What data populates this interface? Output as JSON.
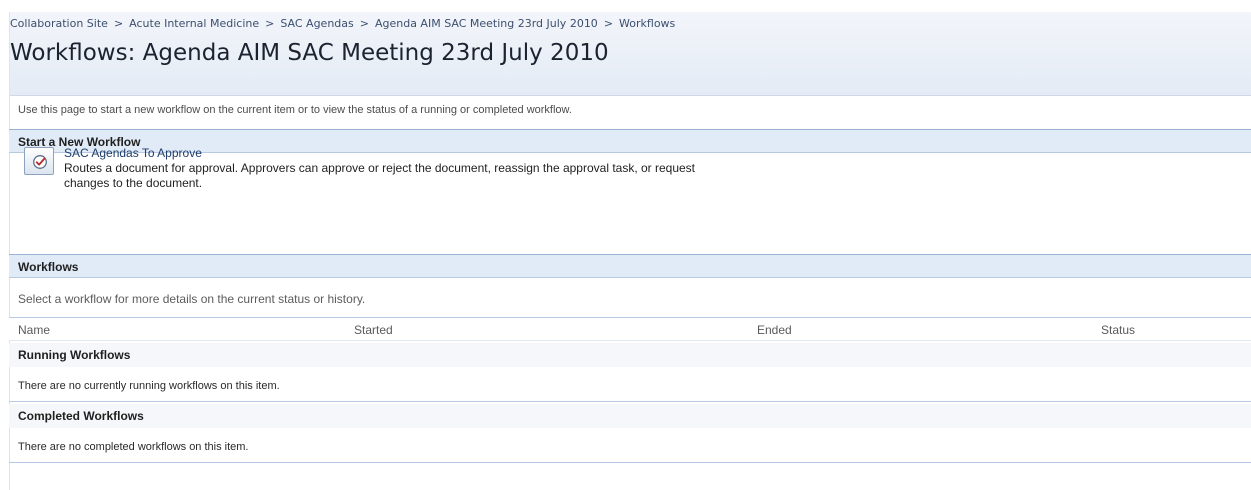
{
  "breadcrumb": [
    "Collaboration Site",
    "Acute Internal Medicine",
    "SAC Agendas",
    "Agenda AIM SAC Meeting 23rd July 2010",
    "Workflows"
  ],
  "breadcrumb_separator": ">",
  "page_title": "Workflows: Agenda AIM SAC Meeting 23rd July 2010",
  "intro_text": "Use this page to start a new workflow on the current item or to view the status of a running or completed workflow.",
  "start_section": {
    "heading": "Start a New Workflow",
    "workflow": {
      "icon": "approval-check-icon",
      "name": "SAC Agendas To Approve",
      "description": "Routes a document for approval. Approvers can approve or reject the document, reassign the approval task, or request changes to the document."
    }
  },
  "workflows_section": {
    "heading": "Workflows",
    "hint": "Select a workflow for more details on the current status or history.",
    "columns": [
      "Name",
      "Started",
      "Ended",
      "Status"
    ],
    "running": {
      "heading": "Running Workflows",
      "empty_message": "There are no currently running workflows on this item."
    },
    "completed": {
      "heading": "Completed Workflows",
      "empty_message": "There are no completed workflows on this item."
    }
  },
  "colors": {
    "header_band": "#e4ebf5",
    "section_header": "#e1ebf8",
    "section_border": "#9bb3d2",
    "link": "#1f3d6b"
  }
}
